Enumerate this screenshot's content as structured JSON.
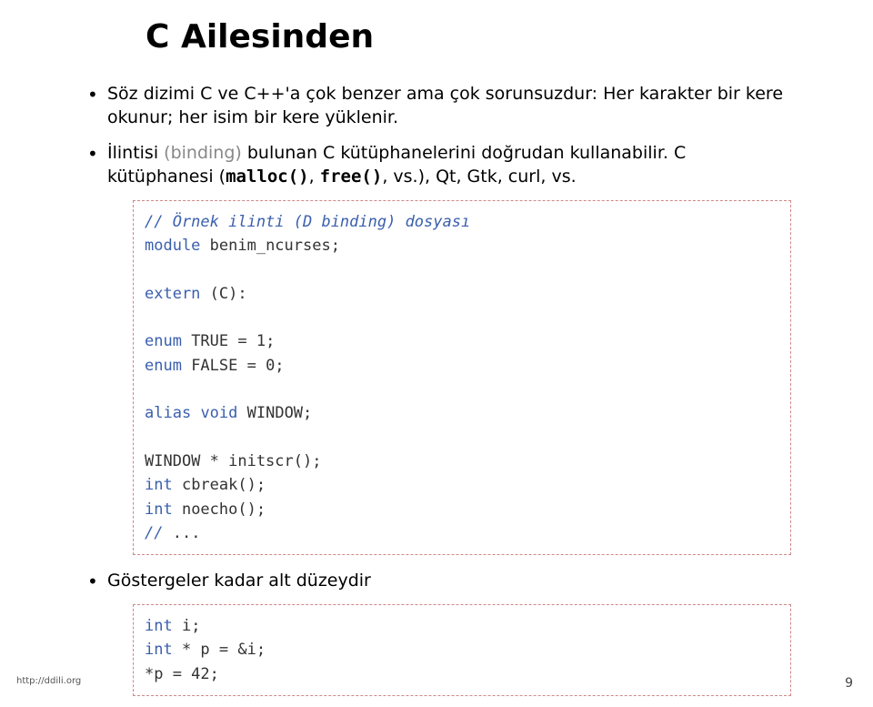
{
  "title": "C Ailesinden",
  "bullet1_a": "Söz dizimi C ve C++'a çok benzer ama çok sorunsuzdur: Her karakter bir kere okunur; her isim bir kere yüklenir.",
  "bullet2_a": "İlintisi ",
  "bullet2_binding": "(binding)",
  "bullet2_b": " bulunan C kütüphanelerini doğrudan kullanabilir. C kütüphanesi (",
  "bullet2_m": "malloc()",
  "bullet2_c": ", ",
  "bullet2_f": "free()",
  "bullet2_d": ", vs.), Qt, Gtk, curl, vs.",
  "code1": {
    "l1a": "// Örnek ilinti (D binding) dosyası",
    "l2a": "module",
    "l2b": " benim_ncurses;",
    "l3a": "extern",
    "l3b": " (C):",
    "l4a": "enum",
    "l4b": " TRUE = 1;",
    "l5a": "enum",
    "l5b": " FALSE = 0;",
    "l6a": "alias",
    "l6b": " ",
    "l6c": "void",
    "l6d": " WINDOW;",
    "l7": "WINDOW * initscr();",
    "l8a": "int",
    "l8b": " cbreak();",
    "l9a": "int",
    "l9b": " noecho();",
    "l10a": "//",
    "l10b": " ..."
  },
  "bullet3": "Göstergeler kadar alt düzeydir",
  "code2": {
    "l1a": "int",
    "l1b": " i;",
    "l2a": "int",
    "l2b": " * p = &i;",
    "l3": "*p = 42;"
  },
  "footer_left": "http://ddili.org",
  "footer_right": "9"
}
